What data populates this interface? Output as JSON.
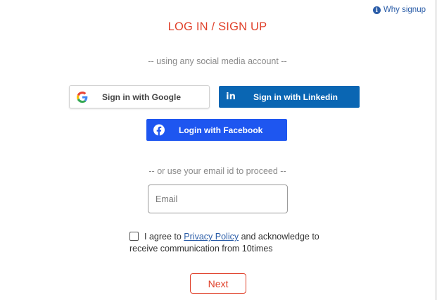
{
  "header": {
    "why_signup": "Why signup",
    "title": "LOG IN / SIGN UP"
  },
  "social": {
    "subtitle": "-- using any social media account --",
    "google_label": "Sign in with Google",
    "linkedin_label": "Sign in with Linkedin",
    "facebook_label": "Login with Facebook"
  },
  "email_section": {
    "subtitle": "-- or use your email id to proceed --",
    "email_placeholder": "Email",
    "email_value": ""
  },
  "consent": {
    "checked": false,
    "text_before": "I agree to ",
    "link_text": "Privacy Policy",
    "text_after": " and acknowledge to",
    "line2": "receive communication from 10times"
  },
  "next_label": "Next",
  "colors": {
    "accent_red": "#e0412b",
    "link_blue": "#2b5da8",
    "linkedin_blue": "#0a66b3",
    "facebook_blue": "#1e56f0"
  }
}
